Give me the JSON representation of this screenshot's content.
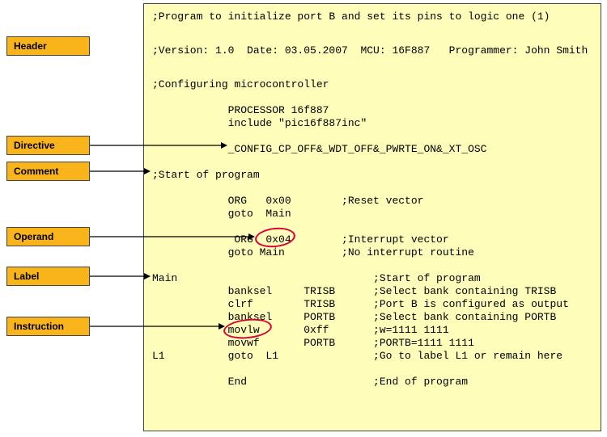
{
  "labels": {
    "header": "Header",
    "directive": "Directive",
    "comment": "Comment",
    "operand": "Operand",
    "label": "Label",
    "instruction": "Instruction"
  },
  "code": {
    "l1": ";Program to initialize port B and set its pins to logic one (1)",
    "l2": ";Version: 1.0  Date: 03.05.2007  MCU: 16F887   Programmer: John Smith",
    "l3": ";Configuring microcontroller",
    "l4": "            PROCESSOR 16f887",
    "l5": "            include \"pic16f887inc\"",
    "l6": "            _CONFIG_CP_OFF&_WDT_OFF&_PWRTE_ON&_XT_OSC",
    "l7": ";Start of program",
    "l8": "            ORG   0x00        ;Reset vector",
    "l9": "            goto  Main",
    "l10": "             ORG  0x04        ;Interrupt vector",
    "l11": "            goto Main         ;No interrupt routine",
    "l12": "Main                               ;Start of program",
    "l13": "            banksel     TRISB      ;Select bank containing TRISB",
    "l14": "            clrf        TRISB      ;Port B is configured as output",
    "l15": "            banksel     PORTB      ;Select bank containing PORTB",
    "l16": "            movlw       0xff       ;w=1111 1111",
    "l17": "            movwf       PORTB      ;PORTB=1111 1111",
    "l18": "L1          goto  L1               ;Go to label L1 or remain here",
    "l19": "            End                    ;End of program"
  }
}
